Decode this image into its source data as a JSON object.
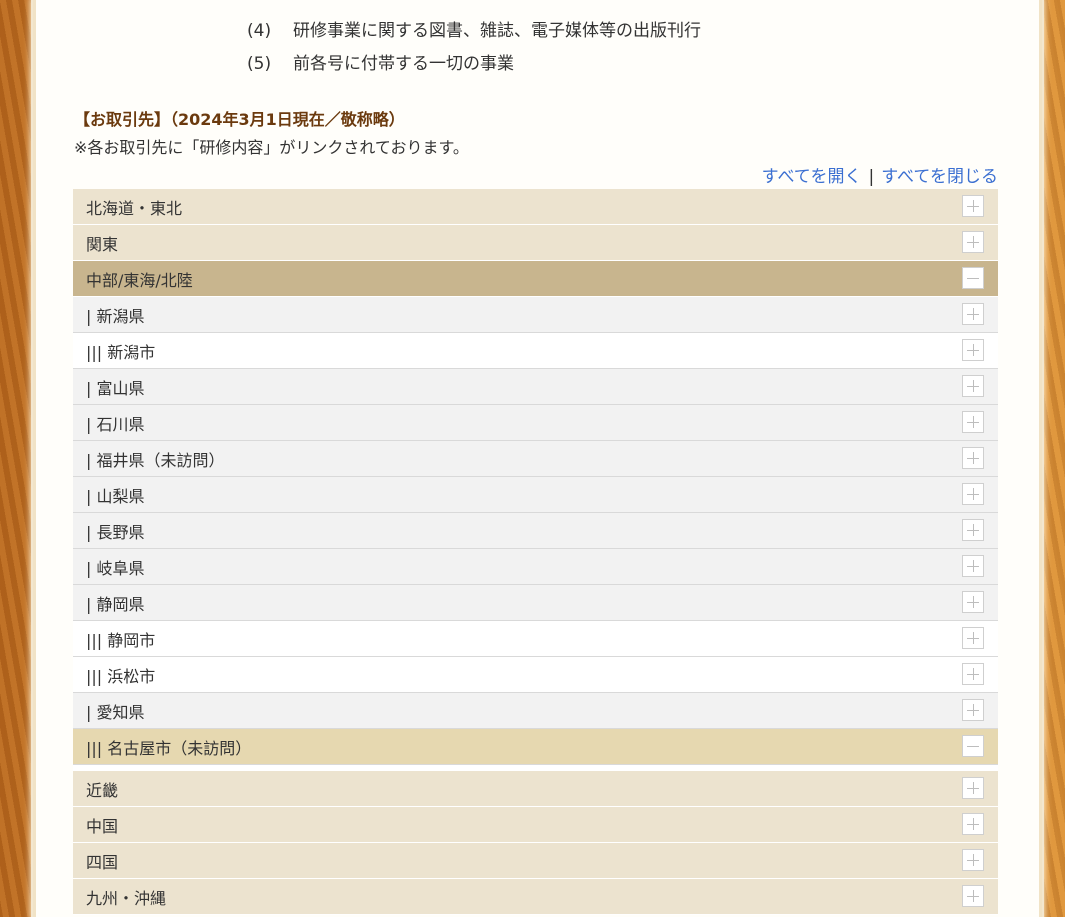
{
  "intro_list": [
    {
      "num": "(4)",
      "text": "研修事業に関する図書、雑誌、電子媒体等の出版刊行"
    },
    {
      "num": "(5)",
      "text": "前各号に付帯する一切の事業"
    }
  ],
  "section_title": "【お取引先】（2024年3月1日現在／敬称略）",
  "note": "※各お取引先に「研修内容」がリンクされております。",
  "controls": {
    "open_all": "すべてを開く",
    "separator": "|",
    "close_all": "すべてを閉じる"
  },
  "accordion": {
    "rows": [
      {
        "label": "北海道・東北",
        "level": "region",
        "state": "collapsed"
      },
      {
        "label": "関東",
        "level": "region",
        "state": "collapsed"
      },
      {
        "label": "中部/東海/北陸",
        "level": "region",
        "state": "expanded"
      },
      {
        "label": "| 新潟県",
        "level": "pref",
        "state": "collapsed"
      },
      {
        "label": "||| 新潟市",
        "level": "city",
        "state": "collapsed"
      },
      {
        "label": "| 富山県",
        "level": "pref",
        "state": "collapsed"
      },
      {
        "label": "| 石川県",
        "level": "pref",
        "state": "collapsed"
      },
      {
        "label": "| 福井県（未訪問）",
        "level": "pref",
        "state": "collapsed"
      },
      {
        "label": "| 山梨県",
        "level": "pref",
        "state": "collapsed"
      },
      {
        "label": "| 長野県",
        "level": "pref",
        "state": "collapsed"
      },
      {
        "label": "| 岐阜県",
        "level": "pref",
        "state": "collapsed"
      },
      {
        "label": "| 静岡県",
        "level": "pref",
        "state": "collapsed"
      },
      {
        "label": "||| 静岡市",
        "level": "city",
        "state": "collapsed"
      },
      {
        "label": "||| 浜松市",
        "level": "city",
        "state": "collapsed"
      },
      {
        "label": "| 愛知県",
        "level": "pref",
        "state": "collapsed"
      },
      {
        "label": "||| 名古屋市（未訪問）",
        "level": "city",
        "state": "expanded"
      },
      {
        "label": "近畿",
        "level": "region",
        "state": "collapsed"
      },
      {
        "label": "中国",
        "level": "region",
        "state": "collapsed"
      },
      {
        "label": "四国",
        "level": "region",
        "state": "collapsed"
      },
      {
        "label": "九州・沖縄",
        "level": "region",
        "state": "collapsed"
      }
    ]
  },
  "icons": {
    "collapsed": "plus-icon",
    "expanded": "minus-icon"
  }
}
